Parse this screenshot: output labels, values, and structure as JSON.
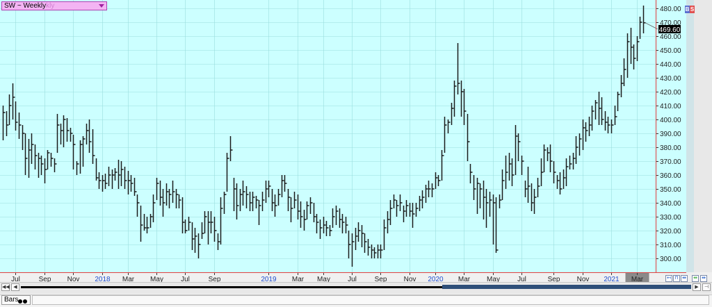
{
  "symbol": {
    "label": "SW ~ Weekly",
    "ghost": "kly"
  },
  "badges": {
    "b": "B",
    "s": "S"
  },
  "bottom": {
    "tab_label": "Bars"
  },
  "colors": {
    "plot_bg": "#ccffff",
    "grid": "#9adede",
    "bar": "#1a1a1a",
    "axis_line": "#e04040",
    "year_label": "#1f4fd0",
    "price_tag_bg": "#000000"
  },
  "icons": [
    "scroll-left-icon",
    "chevron-left-icon",
    "chevron-right-icon",
    "scroll-right-icon",
    "zoom-in-icon",
    "zoom-out-icon",
    "zoom-fit-icon"
  ],
  "chart_data": {
    "type": "bar",
    "title": "SW ~ Weekly",
    "ylim": [
      290,
      486
    ],
    "y_ticks": [
      300,
      310,
      320,
      330,
      340,
      350,
      360,
      370,
      380,
      390,
      400,
      410,
      420,
      430,
      440,
      450,
      460,
      470,
      480
    ],
    "last_price": "469.60",
    "x_ticks": [
      {
        "label": "Jul",
        "bar": 4,
        "year": false
      },
      {
        "label": "Sep",
        "bar": 13,
        "year": false
      },
      {
        "label": "Nov",
        "bar": 22,
        "year": false
      },
      {
        "label": "2018",
        "bar": 31,
        "year": true
      },
      {
        "label": "Mar",
        "bar": 39,
        "year": false
      },
      {
        "label": "May",
        "bar": 48,
        "year": false
      },
      {
        "label": "Jul",
        "bar": 57,
        "year": false
      },
      {
        "label": "Sep",
        "bar": 66,
        "year": false
      },
      {
        "label": "2019",
        "bar": 83,
        "year": true
      },
      {
        "label": "Mar",
        "bar": 92,
        "year": false
      },
      {
        "label": "May",
        "bar": 100,
        "year": false
      },
      {
        "label": "Jul",
        "bar": 109,
        "year": false
      },
      {
        "label": "Sep",
        "bar": 118,
        "year": false
      },
      {
        "label": "Nov",
        "bar": 127,
        "year": false
      },
      {
        "label": "2020",
        "bar": 135,
        "year": true
      },
      {
        "label": "Mar",
        "bar": 144,
        "year": false
      },
      {
        "label": "May",
        "bar": 153,
        "year": false
      },
      {
        "label": "Jul",
        "bar": 162,
        "year": false
      },
      {
        "label": "Sep",
        "bar": 172,
        "year": false
      },
      {
        "label": "Nov",
        "bar": 181,
        "year": false
      },
      {
        "label": "2021",
        "bar": 190,
        "year": true
      },
      {
        "label": "Mar",
        "bar": 198,
        "year": false,
        "highlight": true
      }
    ],
    "bars": [
      [
        410,
        385,
        405
      ],
      [
        406,
        388,
        396
      ],
      [
        418,
        396,
        410
      ],
      [
        426,
        400,
        416
      ],
      [
        413,
        392,
        398
      ],
      [
        405,
        386,
        396
      ],
      [
        396,
        378,
        390
      ],
      [
        390,
        360,
        372
      ],
      [
        386,
        358,
        378
      ],
      [
        390,
        368,
        382
      ],
      [
        382,
        364,
        374
      ],
      [
        376,
        358,
        372
      ],
      [
        374,
        360,
        368
      ],
      [
        372,
        354,
        364
      ],
      [
        378,
        364,
        376
      ],
      [
        376,
        366,
        372
      ],
      [
        372,
        362,
        368
      ],
      [
        404,
        376,
        396
      ],
      [
        397,
        382,
        392
      ],
      [
        403,
        380,
        400
      ],
      [
        401,
        384,
        392
      ],
      [
        394,
        384,
        390
      ],
      [
        389,
        364,
        382
      ],
      [
        370,
        360,
        368
      ],
      [
        385,
        361,
        382
      ],
      [
        388,
        366,
        386
      ],
      [
        397,
        382,
        392
      ],
      [
        400,
        376,
        384
      ],
      [
        393,
        368,
        374
      ],
      [
        372,
        356,
        358
      ],
      [
        362,
        350,
        356
      ],
      [
        360,
        348,
        356
      ],
      [
        361,
        350,
        354
      ],
      [
        366,
        352,
        360
      ],
      [
        364,
        350,
        360
      ],
      [
        365,
        356,
        362
      ],
      [
        371,
        350,
        360
      ],
      [
        370,
        352,
        364
      ],
      [
        366,
        350,
        356
      ],
      [
        363,
        346,
        356
      ],
      [
        360,
        348,
        354
      ],
      [
        358,
        345,
        348
      ],
      [
        346,
        330,
        340
      ],
      [
        338,
        312,
        324
      ],
      [
        332,
        320,
        322
      ],
      [
        330,
        318,
        322
      ],
      [
        332,
        322,
        330
      ],
      [
        346,
        326,
        340
      ],
      [
        358,
        342,
        354
      ],
      [
        356,
        338,
        344
      ],
      [
        350,
        330,
        340
      ],
      [
        354,
        338,
        348
      ],
      [
        350,
        336,
        346
      ],
      [
        356,
        340,
        348
      ],
      [
        350,
        336,
        346
      ],
      [
        346,
        336,
        342
      ],
      [
        344,
        318,
        326
      ],
      [
        328,
        318,
        320
      ],
      [
        330,
        320,
        326
      ],
      [
        326,
        306,
        314
      ],
      [
        322,
        304,
        316
      ],
      [
        318,
        300,
        310
      ],
      [
        326,
        314,
        318
      ],
      [
        334,
        318,
        330
      ],
      [
        334,
        310,
        326
      ],
      [
        334,
        318,
        326
      ],
      [
        330,
        312,
        320
      ],
      [
        318,
        306,
        312
      ],
      [
        344,
        310,
        336
      ],
      [
        348,
        332,
        346
      ],
      [
        376,
        348,
        372
      ],
      [
        388,
        370,
        378
      ],
      [
        358,
        334,
        350
      ],
      [
        354,
        328,
        338
      ],
      [
        350,
        334,
        346
      ],
      [
        356,
        338,
        348
      ],
      [
        352,
        336,
        346
      ],
      [
        348,
        334,
        340
      ],
      [
        348,
        334,
        344
      ],
      [
        345,
        336,
        342
      ],
      [
        342,
        324,
        338
      ],
      [
        348,
        334,
        342
      ],
      [
        356,
        340,
        350
      ],
      [
        356,
        344,
        352
      ],
      [
        350,
        334,
        340
      ],
      [
        346,
        330,
        338
      ],
      [
        350,
        338,
        346
      ],
      [
        360,
        344,
        356
      ],
      [
        360,
        348,
        354
      ],
      [
        350,
        334,
        344
      ],
      [
        344,
        326,
        336
      ],
      [
        348,
        336,
        342
      ],
      [
        346,
        328,
        334
      ],
      [
        341,
        322,
        330
      ],
      [
        335,
        320,
        328
      ],
      [
        341,
        328,
        338
      ],
      [
        344,
        332,
        340
      ],
      [
        340,
        326,
        330
      ],
      [
        332,
        318,
        326
      ],
      [
        328,
        314,
        322
      ],
      [
        330,
        318,
        324
      ],
      [
        327,
        316,
        322
      ],
      [
        324,
        316,
        320
      ],
      [
        336,
        322,
        330
      ],
      [
        338,
        324,
        334
      ],
      [
        336,
        322,
        328
      ],
      [
        332,
        318,
        326
      ],
      [
        330,
        318,
        324
      ],
      [
        320,
        300,
        310
      ],
      [
        318,
        294,
        312
      ],
      [
        322,
        306,
        316
      ],
      [
        326,
        312,
        320
      ],
      [
        324,
        308,
        318
      ],
      [
        318,
        304,
        312
      ],
      [
        314,
        302,
        308
      ],
      [
        310,
        300,
        306
      ],
      [
        308,
        300,
        304
      ],
      [
        310,
        300,
        306
      ],
      [
        310,
        300,
        306
      ],
      [
        328,
        306,
        322
      ],
      [
        334,
        318,
        328
      ],
      [
        342,
        324,
        336
      ],
      [
        346,
        336,
        342
      ],
      [
        342,
        330,
        338
      ],
      [
        346,
        334,
        340
      ],
      [
        338,
        326,
        334
      ],
      [
        342,
        330,
        338
      ],
      [
        340,
        330,
        334
      ],
      [
        340,
        322,
        332
      ],
      [
        340,
        330,
        336
      ],
      [
        345,
        334,
        342
      ],
      [
        349,
        336,
        344
      ],
      [
        353,
        340,
        350
      ],
      [
        356,
        344,
        350
      ],
      [
        354,
        344,
        350
      ],
      [
        362,
        350,
        358
      ],
      [
        360,
        352,
        356
      ],
      [
        378,
        356,
        374
      ],
      [
        402,
        376,
        396
      ],
      [
        400,
        390,
        398
      ],
      [
        412,
        396,
        408
      ],
      [
        428,
        402,
        424
      ],
      [
        455,
        418,
        426
      ],
      [
        428,
        402,
        420
      ],
      [
        422,
        396,
        406
      ],
      [
        404,
        370,
        384
      ],
      [
        368,
        354,
        362
      ],
      [
        360,
        342,
        350
      ],
      [
        358,
        332,
        354
      ],
      [
        354,
        336,
        350
      ],
      [
        356,
        328,
        344
      ],
      [
        350,
        322,
        340
      ],
      [
        348,
        330,
        342
      ],
      [
        346,
        310,
        340
      ],
      [
        344,
        304,
        306
      ],
      [
        346,
        336,
        342
      ],
      [
        364,
        342,
        356
      ],
      [
        374,
        350,
        362
      ],
      [
        376,
        356,
        368
      ],
      [
        372,
        352,
        360
      ],
      [
        396,
        360,
        388
      ],
      [
        390,
        370,
        384
      ],
      [
        374,
        360,
        370
      ],
      [
        356,
        344,
        350
      ],
      [
        366,
        340,
        352
      ],
      [
        354,
        334,
        340
      ],
      [
        350,
        332,
        344
      ],
      [
        358,
        344,
        352
      ],
      [
        372,
        352,
        362
      ],
      [
        382,
        362,
        378
      ],
      [
        380,
        370,
        376
      ],
      [
        382,
        362,
        370
      ],
      [
        370,
        354,
        362
      ],
      [
        360,
        350,
        356
      ],
      [
        362,
        346,
        350
      ],
      [
        364,
        350,
        358
      ],
      [
        372,
        352,
        366
      ],
      [
        374,
        364,
        368
      ],
      [
        376,
        364,
        372
      ],
      [
        388,
        368,
        380
      ],
      [
        390,
        374,
        386
      ],
      [
        400,
        378,
        394
      ],
      [
        398,
        384,
        392
      ],
      [
        402,
        388,
        396
      ],
      [
        410,
        392,
        406
      ],
      [
        414,
        400,
        412
      ],
      [
        420,
        396,
        408
      ],
      [
        416,
        396,
        400
      ],
      [
        406,
        392,
        398
      ],
      [
        402,
        390,
        396
      ],
      [
        400,
        390,
        396
      ],
      [
        410,
        396,
        402
      ],
      [
        420,
        406,
        418
      ],
      [
        432,
        416,
        426
      ],
      [
        444,
        424,
        436
      ],
      [
        462,
        430,
        456
      ],
      [
        466,
        440,
        452
      ],
      [
        454,
        436,
        444
      ],
      [
        460,
        442,
        456
      ],
      [
        474,
        458,
        470
      ],
      [
        482,
        462,
        469.6
      ]
    ]
  }
}
